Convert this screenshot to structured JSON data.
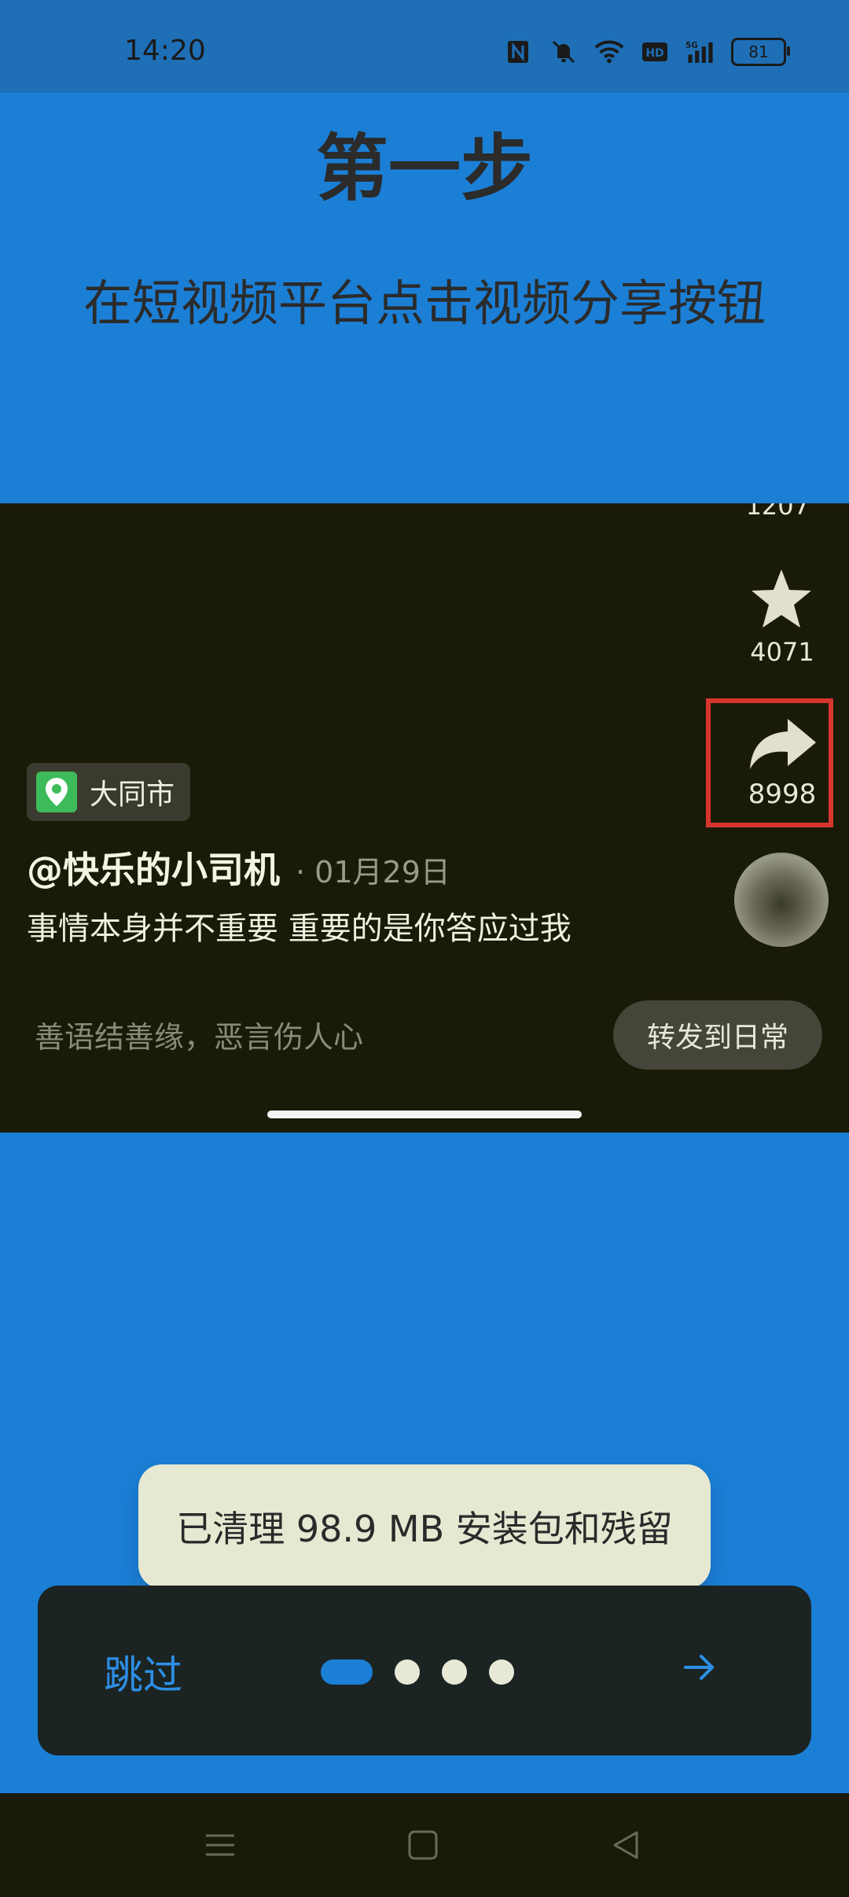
{
  "colors": {
    "accent": "#1b7fd6",
    "highlight": "#d7362c"
  },
  "status_bar": {
    "time": "14:20",
    "icons": [
      "nfc-icon",
      "mute-icon",
      "wifi-icon",
      "hd-icon",
      "signal-5g-icon",
      "battery-icon"
    ],
    "battery_level": "81"
  },
  "guide": {
    "title": "第一步",
    "description": "在短视频平台点击视频分享按钮"
  },
  "demo_video": {
    "top_count_partial": "1207",
    "favorite_count": "4071",
    "share_count": "8998",
    "location": "大同市",
    "author": "@快乐的小司机",
    "date": "· 01月29日",
    "caption": "事情本身并不重要 重要的是你答应过我",
    "comment_placeholder": "善语结善缘，恶言伤人心",
    "forward_button": "转发到日常"
  },
  "toast": {
    "message": "已清理 98.9 MB 安装包和残留"
  },
  "onboarding_nav": {
    "skip_label": "跳过",
    "pages_total": 4,
    "current_page": 1
  },
  "system_nav": {
    "buttons": [
      "menu-icon",
      "home-icon",
      "back-icon"
    ]
  }
}
